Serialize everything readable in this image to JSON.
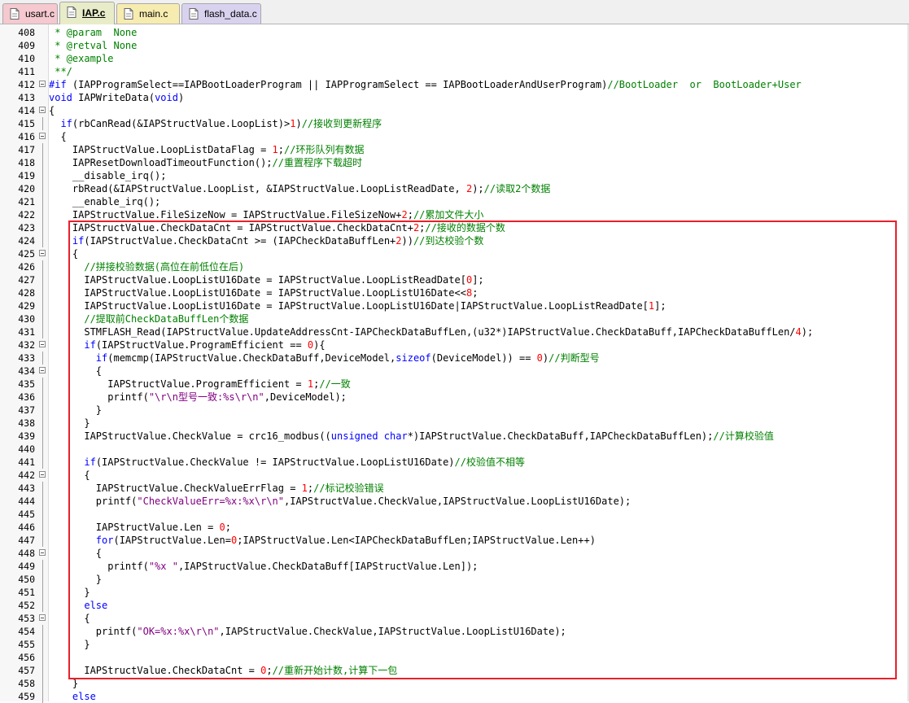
{
  "tabs": [
    {
      "name": "usart.c",
      "bg": "#f5c9cf",
      "icon": "c-file-icon",
      "active": false
    },
    {
      "name": "IAP.c",
      "bg": "#e8ecc9",
      "icon": "c-file-icon",
      "active": true
    },
    {
      "name": "main.c",
      "bg": "#f7ecb0",
      "icon": "c-file-icon",
      "active": false
    },
    {
      "name": "flash_data.c",
      "bg": "#d9d2ef",
      "icon": "c-file-icon",
      "active": false
    }
  ],
  "colors": {
    "keyword": "#0000ff",
    "comment": "#008000",
    "string": "#800080",
    "number": "#ff0000",
    "highlight_box": "#e8202a"
  },
  "lines": [
    {
      "n": "408",
      "fold": false,
      "segs": [
        [
          "c",
          " * @param  None"
        ]
      ]
    },
    {
      "n": "409",
      "fold": false,
      "segs": [
        [
          "c",
          " * @retval None"
        ]
      ]
    },
    {
      "n": "410",
      "fold": false,
      "segs": [
        [
          "c",
          " * @example"
        ]
      ]
    },
    {
      "n": "411",
      "fold": false,
      "segs": [
        [
          "c",
          " **/"
        ]
      ]
    },
    {
      "n": "412",
      "fold": true,
      "segs": [
        [
          "k",
          "#if"
        ],
        [
          "t",
          " (IAPProgramSelect==IAPBootLoaderProgram || IAPProgramSelect == IAPBootLoaderAndUserProgram)"
        ],
        [
          "c",
          "//BootLoader  or  BootLoader+User"
        ]
      ]
    },
    {
      "n": "413",
      "fold": false,
      "segs": [
        [
          "k",
          "void"
        ],
        [
          "t",
          " IAPWriteData("
        ],
        [
          "k",
          "void"
        ],
        [
          "t",
          ")"
        ]
      ]
    },
    {
      "n": "414",
      "fold": true,
      "segs": [
        [
          "t",
          "{"
        ]
      ]
    },
    {
      "n": "415",
      "fold": false,
      "segs": [
        [
          "t",
          "  "
        ],
        [
          "k",
          "if"
        ],
        [
          "t",
          "(rbCanRead(&IAPStructValue.LoopList)>"
        ],
        [
          "n",
          "1"
        ],
        [
          "t",
          ")"
        ],
        [
          "c",
          "//接收到更新程序"
        ]
      ]
    },
    {
      "n": "416",
      "fold": true,
      "segs": [
        [
          "t",
          "  {"
        ]
      ]
    },
    {
      "n": "417",
      "fold": false,
      "segs": [
        [
          "t",
          "    IAPStructValue.LoopListDataFlag = "
        ],
        [
          "n",
          "1"
        ],
        [
          "t",
          ";"
        ],
        [
          "c",
          "//环形队列有数据"
        ]
      ]
    },
    {
      "n": "418",
      "fold": false,
      "segs": [
        [
          "t",
          "    IAPResetDownloadTimeoutFunction();"
        ],
        [
          "c",
          "//重置程序下载超时"
        ]
      ]
    },
    {
      "n": "419",
      "fold": false,
      "segs": [
        [
          "t",
          "    __disable_irq();"
        ]
      ]
    },
    {
      "n": "420",
      "fold": false,
      "segs": [
        [
          "t",
          "    rbRead(&IAPStructValue.LoopList, &IAPStructValue.LoopListReadDate, "
        ],
        [
          "n",
          "2"
        ],
        [
          "t",
          ");"
        ],
        [
          "c",
          "//读取2个数据"
        ]
      ]
    },
    {
      "n": "421",
      "fold": false,
      "segs": [
        [
          "t",
          "    __enable_irq();"
        ]
      ]
    },
    {
      "n": "422",
      "fold": false,
      "segs": [
        [
          "t",
          "    IAPStructValue.FileSizeNow = IAPStructValue.FileSizeNow+"
        ],
        [
          "n",
          "2"
        ],
        [
          "t",
          ";"
        ],
        [
          "c",
          "//累加文件大小"
        ]
      ]
    },
    {
      "n": "423",
      "fold": false,
      "segs": [
        [
          "t",
          "    IAPStructValue.CheckDataCnt = IAPStructValue.CheckDataCnt+"
        ],
        [
          "n",
          "2"
        ],
        [
          "t",
          ";"
        ],
        [
          "c",
          "//接收的数据个数"
        ]
      ]
    },
    {
      "n": "424",
      "fold": false,
      "segs": [
        [
          "t",
          "    "
        ],
        [
          "k",
          "if"
        ],
        [
          "t",
          "(IAPStructValue.CheckDataCnt >= (IAPCheckDataBuffLen+"
        ],
        [
          "n",
          "2"
        ],
        [
          "t",
          "))"
        ],
        [
          "c",
          "//到达校验个数"
        ]
      ]
    },
    {
      "n": "425",
      "fold": true,
      "segs": [
        [
          "t",
          "    {"
        ]
      ]
    },
    {
      "n": "426",
      "fold": false,
      "segs": [
        [
          "c",
          "      //拼接校验数据(高位在前低位在后)"
        ]
      ]
    },
    {
      "n": "427",
      "fold": false,
      "segs": [
        [
          "t",
          "      IAPStructValue.LoopListU16Date = IAPStructValue.LoopListReadDate["
        ],
        [
          "n",
          "0"
        ],
        [
          "t",
          "];"
        ]
      ]
    },
    {
      "n": "428",
      "fold": false,
      "segs": [
        [
          "t",
          "      IAPStructValue.LoopListU16Date = IAPStructValue.LoopListU16Date<<"
        ],
        [
          "n",
          "8"
        ],
        [
          "t",
          ";"
        ]
      ]
    },
    {
      "n": "429",
      "fold": false,
      "segs": [
        [
          "t",
          "      IAPStructValue.LoopListU16Date = IAPStructValue.LoopListU16Date|IAPStructValue.LoopListReadDate["
        ],
        [
          "n",
          "1"
        ],
        [
          "t",
          "];"
        ]
      ]
    },
    {
      "n": "430",
      "fold": false,
      "segs": [
        [
          "c",
          "      //提取前CheckDataBuffLen个数据"
        ]
      ]
    },
    {
      "n": "431",
      "fold": false,
      "segs": [
        [
          "t",
          "      STMFLASH_Read(IAPStructValue.UpdateAddressCnt-IAPCheckDataBuffLen,(u32*)IAPStructValue.CheckDataBuff,IAPCheckDataBuffLen/"
        ],
        [
          "n",
          "4"
        ],
        [
          "t",
          ");"
        ]
      ]
    },
    {
      "n": "432",
      "fold": true,
      "segs": [
        [
          "t",
          "      "
        ],
        [
          "k",
          "if"
        ],
        [
          "t",
          "(IAPStructValue.ProgramEfficient == "
        ],
        [
          "n",
          "0"
        ],
        [
          "t",
          "){"
        ]
      ]
    },
    {
      "n": "433",
      "fold": false,
      "segs": [
        [
          "t",
          "        "
        ],
        [
          "k",
          "if"
        ],
        [
          "t",
          "(memcmp(IAPStructValue.CheckDataBuff,DeviceModel,"
        ],
        [
          "k",
          "sizeof"
        ],
        [
          "t",
          "(DeviceModel)) == "
        ],
        [
          "n",
          "0"
        ],
        [
          "t",
          ")"
        ],
        [
          "c",
          "//判断型号"
        ]
      ]
    },
    {
      "n": "434",
      "fold": true,
      "segs": [
        [
          "t",
          "        {"
        ]
      ]
    },
    {
      "n": "435",
      "fold": false,
      "segs": [
        [
          "t",
          "          IAPStructValue.ProgramEfficient = "
        ],
        [
          "n",
          "1"
        ],
        [
          "t",
          ";"
        ],
        [
          "c",
          "//一致"
        ]
      ]
    },
    {
      "n": "436",
      "fold": false,
      "segs": [
        [
          "t",
          "          printf("
        ],
        [
          "s",
          "\"\\r\\n型号一致:%s\\r\\n\""
        ],
        [
          "t",
          ",DeviceModel);"
        ]
      ]
    },
    {
      "n": "437",
      "fold": false,
      "segs": [
        [
          "t",
          "        }"
        ]
      ]
    },
    {
      "n": "438",
      "fold": false,
      "segs": [
        [
          "t",
          "      }"
        ]
      ]
    },
    {
      "n": "439",
      "fold": false,
      "segs": [
        [
          "t",
          "      IAPStructValue.CheckValue = crc16_modbus(("
        ],
        [
          "k",
          "unsigned char"
        ],
        [
          "t",
          "*)IAPStructValue.CheckDataBuff,IAPCheckDataBuffLen);"
        ],
        [
          "c",
          "//计算校验值"
        ]
      ]
    },
    {
      "n": "440",
      "fold": false,
      "segs": []
    },
    {
      "n": "441",
      "fold": false,
      "segs": [
        [
          "t",
          "      "
        ],
        [
          "k",
          "if"
        ],
        [
          "t",
          "(IAPStructValue.CheckValue != IAPStructValue.LoopListU16Date)"
        ],
        [
          "c",
          "//校验值不相等"
        ]
      ]
    },
    {
      "n": "442",
      "fold": true,
      "segs": [
        [
          "t",
          "      {"
        ]
      ]
    },
    {
      "n": "443",
      "fold": false,
      "segs": [
        [
          "t",
          "        IAPStructValue.CheckValueErrFlag = "
        ],
        [
          "n",
          "1"
        ],
        [
          "t",
          ";"
        ],
        [
          "c",
          "//标记校验错误"
        ]
      ]
    },
    {
      "n": "444",
      "fold": false,
      "segs": [
        [
          "t",
          "        printf("
        ],
        [
          "s",
          "\"CheckValueErr=%x:%x\\r\\n\""
        ],
        [
          "t",
          ",IAPStructValue.CheckValue,IAPStructValue.LoopListU16Date);"
        ]
      ]
    },
    {
      "n": "445",
      "fold": false,
      "segs": []
    },
    {
      "n": "446",
      "fold": false,
      "segs": [
        [
          "t",
          "        IAPStructValue.Len = "
        ],
        [
          "n",
          "0"
        ],
        [
          "t",
          ";"
        ]
      ]
    },
    {
      "n": "447",
      "fold": false,
      "segs": [
        [
          "t",
          "        "
        ],
        [
          "k",
          "for"
        ],
        [
          "t",
          "(IAPStructValue.Len="
        ],
        [
          "n",
          "0"
        ],
        [
          "t",
          ";IAPStructValue.Len<IAPCheckDataBuffLen;IAPStructValue.Len++)"
        ]
      ]
    },
    {
      "n": "448",
      "fold": true,
      "segs": [
        [
          "t",
          "        {"
        ]
      ]
    },
    {
      "n": "449",
      "fold": false,
      "segs": [
        [
          "t",
          "          printf("
        ],
        [
          "s",
          "\"%x \""
        ],
        [
          "t",
          ",IAPStructValue.CheckDataBuff[IAPStructValue.Len]);"
        ]
      ]
    },
    {
      "n": "450",
      "fold": false,
      "segs": [
        [
          "t",
          "        }"
        ]
      ]
    },
    {
      "n": "451",
      "fold": false,
      "segs": [
        [
          "t",
          "      }"
        ]
      ]
    },
    {
      "n": "452",
      "fold": false,
      "segs": [
        [
          "k",
          "      else"
        ]
      ]
    },
    {
      "n": "453",
      "fold": true,
      "segs": [
        [
          "t",
          "      {"
        ]
      ]
    },
    {
      "n": "454",
      "fold": false,
      "segs": [
        [
          "t",
          "        printf("
        ],
        [
          "s",
          "\"OK=%x:%x\\r\\n\""
        ],
        [
          "t",
          ",IAPStructValue.CheckValue,IAPStructValue.LoopListU16Date);"
        ]
      ]
    },
    {
      "n": "455",
      "fold": false,
      "segs": [
        [
          "t",
          "      }"
        ]
      ]
    },
    {
      "n": "456",
      "fold": false,
      "segs": []
    },
    {
      "n": "457",
      "fold": false,
      "segs": [
        [
          "t",
          "      IAPStructValue.CheckDataCnt = "
        ],
        [
          "n",
          "0"
        ],
        [
          "t",
          ";"
        ],
        [
          "c",
          "//重新开始计数,计算下一包"
        ]
      ]
    },
    {
      "n": "458",
      "fold": false,
      "segs": [
        [
          "t",
          "    }"
        ]
      ]
    },
    {
      "n": "459",
      "fold": false,
      "segs": [
        [
          "k",
          "    else"
        ]
      ]
    }
  ]
}
